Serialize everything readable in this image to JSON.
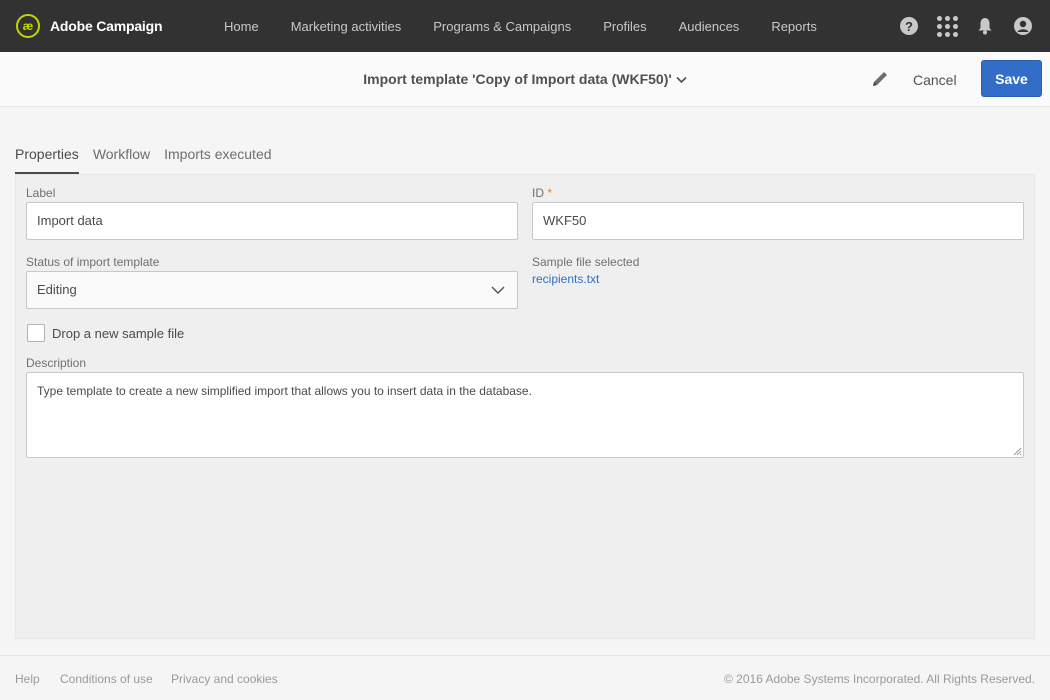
{
  "app": {
    "name": "Adobe Campaign",
    "logo_glyph": "æ"
  },
  "nav": {
    "items": [
      "Home",
      "Marketing activities",
      "Programs & Campaigns",
      "Profiles",
      "Audiences",
      "Reports"
    ]
  },
  "icons": {
    "help": "?",
    "help_icon": "help-icon",
    "apps_icon": "apps-grid-icon",
    "notifications_icon": "bell-icon",
    "profile_icon": "user-avatar-icon"
  },
  "header": {
    "title": "Import template 'Copy of Import data (WKF50)'",
    "edit_icon": "pencil-icon",
    "cancel_label": "Cancel",
    "save_label": "Save"
  },
  "tabs": [
    {
      "label": "Properties",
      "active": true
    },
    {
      "label": "Workflow",
      "active": false
    },
    {
      "label": "Imports executed",
      "active": false
    }
  ],
  "form": {
    "label_field": {
      "label": "Label",
      "value": "Import data"
    },
    "id_field": {
      "label": "ID",
      "required_marker": "*",
      "value": "WKF50"
    },
    "status_field": {
      "label": "Status of import template",
      "value": "Editing"
    },
    "sample_file": {
      "label": "Sample file selected",
      "file_name": "recipients.txt"
    },
    "drop_sample": {
      "label": "Drop a new sample file",
      "checked": false
    },
    "description": {
      "label": "Description",
      "value": "Type template to create a new simplified import that allows you to insert data in the database."
    }
  },
  "footer": {
    "links": [
      "Help",
      "Conditions of use",
      "Privacy and cookies"
    ],
    "copyright": "© 2016 Adobe Systems Incorporated. All Rights Reserved."
  },
  "colors": {
    "topbar": "#323232",
    "accent_logo": "#c4d600",
    "primary": "#326ec8",
    "required": "#e68619"
  }
}
